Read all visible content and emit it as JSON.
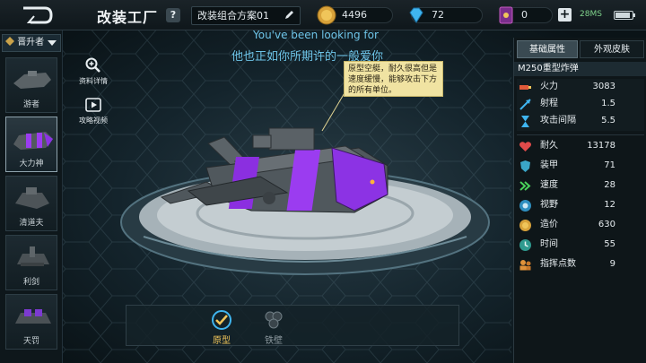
{
  "topbar": {
    "back_icon": "back-arrow-icon",
    "title": "改装工厂",
    "help": "?",
    "plan_name": "改装组合方案01",
    "gold": "4496",
    "diamond": "72",
    "card": "0",
    "plus": "+",
    "ping": "28MS"
  },
  "sidebar": {
    "tier_label": "晋升者",
    "units": [
      {
        "name": "游者"
      },
      {
        "name": "大力神"
      },
      {
        "name": "清道夫"
      },
      {
        "name": "利剑"
      },
      {
        "name": "天罚"
      }
    ]
  },
  "tools": {
    "details_label": "资料详情",
    "video_label": "攻略视频"
  },
  "banner": {
    "line_en": "You've been looking for",
    "line_cn": "他也正如你所期许的一般爱你"
  },
  "tooltip": {
    "text": "原型空艇，耐久很高但是速度缓慢，能够攻击下方的所有单位。"
  },
  "panel": {
    "tab_basic": "基础属性",
    "tab_skin": "外观皮肤",
    "unit_name": "M250重型炸弹",
    "stats_attack": [
      {
        "label": "火力",
        "value": "3083",
        "icon": "firepower-icon"
      },
      {
        "label": "射程",
        "value": "1.5",
        "icon": "range-icon"
      },
      {
        "label": "攻击间隔",
        "value": "5.5",
        "icon": "hourglass-icon"
      }
    ],
    "stats_body": [
      {
        "label": "耐久",
        "value": "13178",
        "icon": "heart-icon"
      },
      {
        "label": "装甲",
        "value": "71",
        "icon": "armor-icon"
      },
      {
        "label": "速度",
        "value": "28",
        "icon": "speed-icon"
      },
      {
        "label": "视野",
        "value": "12",
        "icon": "eye-icon"
      },
      {
        "label": "造价",
        "value": "630",
        "icon": "cost-icon"
      },
      {
        "label": "时间",
        "value": "55",
        "icon": "clock-icon"
      },
      {
        "label": "指挥点数",
        "value": "9",
        "icon": "command-icon"
      }
    ]
  },
  "bottom": {
    "prototype_label": "原型",
    "iron_label": "铁壁"
  },
  "colors": {
    "accent_purple": "#9b3cf0",
    "tooltip_bg": "#f0e3a2",
    "banner_text": "#6ec4e8"
  }
}
